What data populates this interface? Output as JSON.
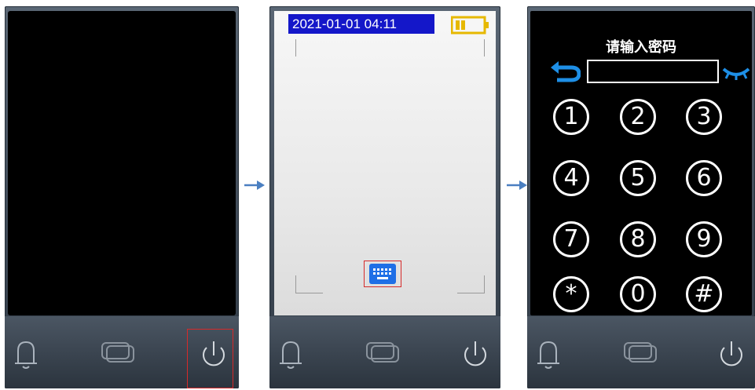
{
  "panels": [
    {
      "name": "screen-off"
    },
    {
      "name": "camera-view"
    },
    {
      "name": "password-entry"
    }
  ],
  "camera_view": {
    "datetime": "2021-01-01   04:11",
    "battery_icon": "battery-low-icon",
    "keyboard_icon": "keyboard-icon"
  },
  "password_entry": {
    "title": "请输入密码",
    "password_value": "",
    "keys": [
      "1",
      "2",
      "3",
      "4",
      "5",
      "6",
      "7",
      "8",
      "9",
      "*",
      "0",
      "#"
    ]
  },
  "bottom_bar_icons": [
    "bell-icon",
    "home-icon",
    "power-icon"
  ],
  "colors": {
    "highlight": "#d62a2a",
    "datetime_bg": "#1417c9",
    "battery": "#e6b800",
    "accent_blue": "#1e8fe6",
    "arrow": "#4a7fc1"
  }
}
